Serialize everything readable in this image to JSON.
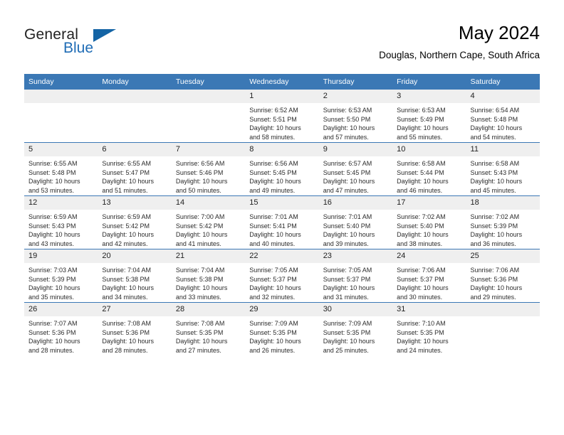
{
  "brand": {
    "name_top": "General",
    "name_bottom": "Blue",
    "logo_icon": "triangle-icon",
    "accent_color": "#1464a5"
  },
  "header": {
    "title": "May 2024",
    "location": "Douglas, Northern Cape, South Africa"
  },
  "colors": {
    "header_bg": "#3b78b5",
    "daynum_bg": "#efefef",
    "text": "#2b2b2b"
  },
  "calendar": {
    "weekday_headers": [
      "Sunday",
      "Monday",
      "Tuesday",
      "Wednesday",
      "Thursday",
      "Friday",
      "Saturday"
    ],
    "weeks": [
      [
        {
          "day": "",
          "sunrise": "",
          "sunset": "",
          "daylight1": "",
          "daylight2": ""
        },
        {
          "day": "",
          "sunrise": "",
          "sunset": "",
          "daylight1": "",
          "daylight2": ""
        },
        {
          "day": "",
          "sunrise": "",
          "sunset": "",
          "daylight1": "",
          "daylight2": ""
        },
        {
          "day": "1",
          "sunrise": "Sunrise: 6:52 AM",
          "sunset": "Sunset: 5:51 PM",
          "daylight1": "Daylight: 10 hours",
          "daylight2": "and 58 minutes."
        },
        {
          "day": "2",
          "sunrise": "Sunrise: 6:53 AM",
          "sunset": "Sunset: 5:50 PM",
          "daylight1": "Daylight: 10 hours",
          "daylight2": "and 57 minutes."
        },
        {
          "day": "3",
          "sunrise": "Sunrise: 6:53 AM",
          "sunset": "Sunset: 5:49 PM",
          "daylight1": "Daylight: 10 hours",
          "daylight2": "and 55 minutes."
        },
        {
          "day": "4",
          "sunrise": "Sunrise: 6:54 AM",
          "sunset": "Sunset: 5:48 PM",
          "daylight1": "Daylight: 10 hours",
          "daylight2": "and 54 minutes."
        }
      ],
      [
        {
          "day": "5",
          "sunrise": "Sunrise: 6:55 AM",
          "sunset": "Sunset: 5:48 PM",
          "daylight1": "Daylight: 10 hours",
          "daylight2": "and 53 minutes."
        },
        {
          "day": "6",
          "sunrise": "Sunrise: 6:55 AM",
          "sunset": "Sunset: 5:47 PM",
          "daylight1": "Daylight: 10 hours",
          "daylight2": "and 51 minutes."
        },
        {
          "day": "7",
          "sunrise": "Sunrise: 6:56 AM",
          "sunset": "Sunset: 5:46 PM",
          "daylight1": "Daylight: 10 hours",
          "daylight2": "and 50 minutes."
        },
        {
          "day": "8",
          "sunrise": "Sunrise: 6:56 AM",
          "sunset": "Sunset: 5:45 PM",
          "daylight1": "Daylight: 10 hours",
          "daylight2": "and 49 minutes."
        },
        {
          "day": "9",
          "sunrise": "Sunrise: 6:57 AM",
          "sunset": "Sunset: 5:45 PM",
          "daylight1": "Daylight: 10 hours",
          "daylight2": "and 47 minutes."
        },
        {
          "day": "10",
          "sunrise": "Sunrise: 6:58 AM",
          "sunset": "Sunset: 5:44 PM",
          "daylight1": "Daylight: 10 hours",
          "daylight2": "and 46 minutes."
        },
        {
          "day": "11",
          "sunrise": "Sunrise: 6:58 AM",
          "sunset": "Sunset: 5:43 PM",
          "daylight1": "Daylight: 10 hours",
          "daylight2": "and 45 minutes."
        }
      ],
      [
        {
          "day": "12",
          "sunrise": "Sunrise: 6:59 AM",
          "sunset": "Sunset: 5:43 PM",
          "daylight1": "Daylight: 10 hours",
          "daylight2": "and 43 minutes."
        },
        {
          "day": "13",
          "sunrise": "Sunrise: 6:59 AM",
          "sunset": "Sunset: 5:42 PM",
          "daylight1": "Daylight: 10 hours",
          "daylight2": "and 42 minutes."
        },
        {
          "day": "14",
          "sunrise": "Sunrise: 7:00 AM",
          "sunset": "Sunset: 5:42 PM",
          "daylight1": "Daylight: 10 hours",
          "daylight2": "and 41 minutes."
        },
        {
          "day": "15",
          "sunrise": "Sunrise: 7:01 AM",
          "sunset": "Sunset: 5:41 PM",
          "daylight1": "Daylight: 10 hours",
          "daylight2": "and 40 minutes."
        },
        {
          "day": "16",
          "sunrise": "Sunrise: 7:01 AM",
          "sunset": "Sunset: 5:40 PM",
          "daylight1": "Daylight: 10 hours",
          "daylight2": "and 39 minutes."
        },
        {
          "day": "17",
          "sunrise": "Sunrise: 7:02 AM",
          "sunset": "Sunset: 5:40 PM",
          "daylight1": "Daylight: 10 hours",
          "daylight2": "and 38 minutes."
        },
        {
          "day": "18",
          "sunrise": "Sunrise: 7:02 AM",
          "sunset": "Sunset: 5:39 PM",
          "daylight1": "Daylight: 10 hours",
          "daylight2": "and 36 minutes."
        }
      ],
      [
        {
          "day": "19",
          "sunrise": "Sunrise: 7:03 AM",
          "sunset": "Sunset: 5:39 PM",
          "daylight1": "Daylight: 10 hours",
          "daylight2": "and 35 minutes."
        },
        {
          "day": "20",
          "sunrise": "Sunrise: 7:04 AM",
          "sunset": "Sunset: 5:38 PM",
          "daylight1": "Daylight: 10 hours",
          "daylight2": "and 34 minutes."
        },
        {
          "day": "21",
          "sunrise": "Sunrise: 7:04 AM",
          "sunset": "Sunset: 5:38 PM",
          "daylight1": "Daylight: 10 hours",
          "daylight2": "and 33 minutes."
        },
        {
          "day": "22",
          "sunrise": "Sunrise: 7:05 AM",
          "sunset": "Sunset: 5:37 PM",
          "daylight1": "Daylight: 10 hours",
          "daylight2": "and 32 minutes."
        },
        {
          "day": "23",
          "sunrise": "Sunrise: 7:05 AM",
          "sunset": "Sunset: 5:37 PM",
          "daylight1": "Daylight: 10 hours",
          "daylight2": "and 31 minutes."
        },
        {
          "day": "24",
          "sunrise": "Sunrise: 7:06 AM",
          "sunset": "Sunset: 5:37 PM",
          "daylight1": "Daylight: 10 hours",
          "daylight2": "and 30 minutes."
        },
        {
          "day": "25",
          "sunrise": "Sunrise: 7:06 AM",
          "sunset": "Sunset: 5:36 PM",
          "daylight1": "Daylight: 10 hours",
          "daylight2": "and 29 minutes."
        }
      ],
      [
        {
          "day": "26",
          "sunrise": "Sunrise: 7:07 AM",
          "sunset": "Sunset: 5:36 PM",
          "daylight1": "Daylight: 10 hours",
          "daylight2": "and 28 minutes."
        },
        {
          "day": "27",
          "sunrise": "Sunrise: 7:08 AM",
          "sunset": "Sunset: 5:36 PM",
          "daylight1": "Daylight: 10 hours",
          "daylight2": "and 28 minutes."
        },
        {
          "day": "28",
          "sunrise": "Sunrise: 7:08 AM",
          "sunset": "Sunset: 5:35 PM",
          "daylight1": "Daylight: 10 hours",
          "daylight2": "and 27 minutes."
        },
        {
          "day": "29",
          "sunrise": "Sunrise: 7:09 AM",
          "sunset": "Sunset: 5:35 PM",
          "daylight1": "Daylight: 10 hours",
          "daylight2": "and 26 minutes."
        },
        {
          "day": "30",
          "sunrise": "Sunrise: 7:09 AM",
          "sunset": "Sunset: 5:35 PM",
          "daylight1": "Daylight: 10 hours",
          "daylight2": "and 25 minutes."
        },
        {
          "day": "31",
          "sunrise": "Sunrise: 7:10 AM",
          "sunset": "Sunset: 5:35 PM",
          "daylight1": "Daylight: 10 hours",
          "daylight2": "and 24 minutes."
        },
        {
          "day": "",
          "sunrise": "",
          "sunset": "",
          "daylight1": "",
          "daylight2": ""
        }
      ]
    ]
  }
}
